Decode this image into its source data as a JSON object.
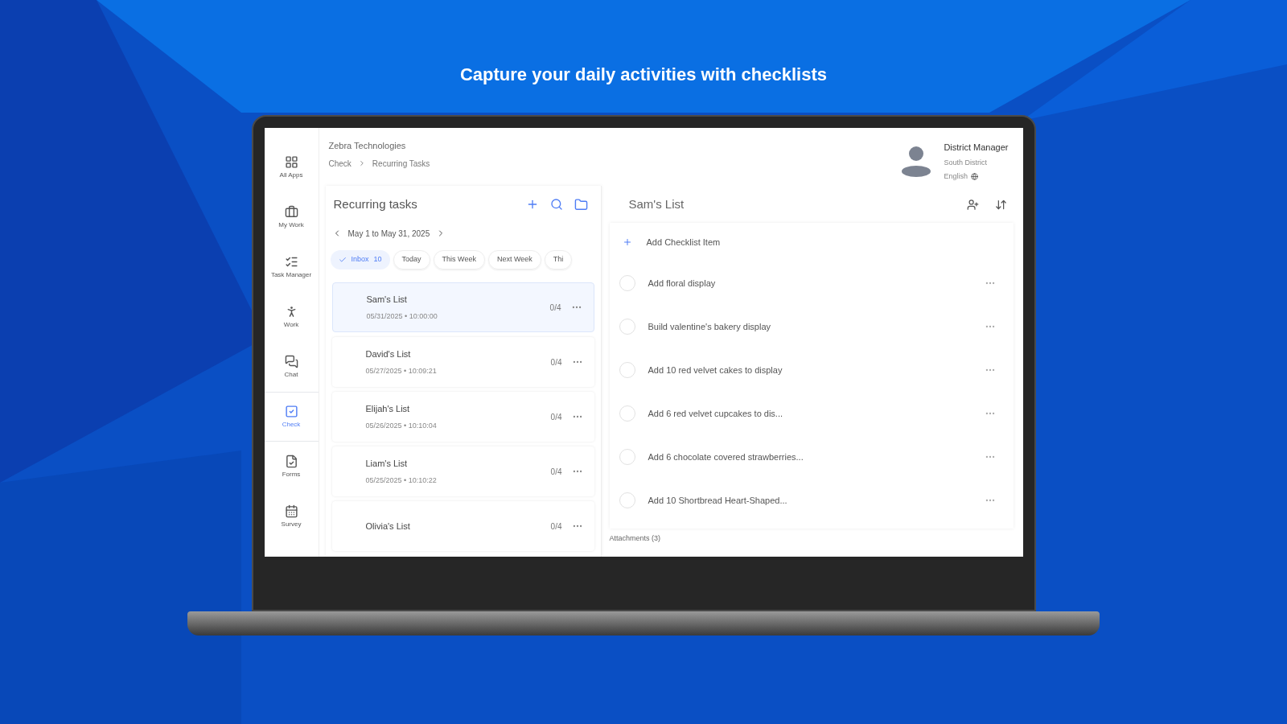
{
  "headline": "Capture your daily activities with checklists",
  "app": {
    "sidebar": {
      "items": [
        {
          "kind": "grid",
          "label": "All Apps",
          "selected": false
        },
        {
          "kind": "briefcase",
          "label": "My Work",
          "selected": false
        },
        {
          "kind": "tasks",
          "label": "Task Manager",
          "selected": false
        },
        {
          "kind": "person",
          "label": "Work",
          "selected": false
        },
        {
          "kind": "chat",
          "label": "Chat",
          "selected": false
        },
        {
          "kind": "check",
          "label": "Check",
          "selected": true
        },
        {
          "kind": "forms",
          "label": "Forms",
          "selected": false
        },
        {
          "kind": "survey",
          "label": "Survey",
          "selected": false
        }
      ]
    },
    "header": {
      "organization": "Zebra Technologies",
      "breadcrumbs": [
        "Check",
        "Recurring Tasks"
      ],
      "user": {
        "role": "District Manager",
        "district": "South District",
        "language": "English"
      }
    },
    "list_panel": {
      "title": "Recurring tasks",
      "date_range": "May 1 to May 31, 2025",
      "filters": [
        {
          "label": "Inbox",
          "count": "10",
          "selected": true
        },
        {
          "label": "Today",
          "selected": false
        },
        {
          "label": "This Week",
          "selected": false
        },
        {
          "label": "Next Week",
          "selected": false
        },
        {
          "label": "Thi",
          "selected": false
        }
      ],
      "lists": [
        {
          "name": "Sam's List",
          "date": "05/31/2025 • 10:00:00",
          "progress": "0/4",
          "selected": true
        },
        {
          "name": "David's List",
          "date": "05/27/2025 • 10:09:21",
          "progress": "0/4",
          "selected": false
        },
        {
          "name": "Elijah's List",
          "date": "05/26/2025 • 10:10:04",
          "progress": "0/4",
          "selected": false
        },
        {
          "name": "Liam's List",
          "date": "05/25/2025 • 10:10:22",
          "progress": "0/4",
          "selected": false
        },
        {
          "name": "Olivia's List",
          "progress": "0/4",
          "selected": false
        }
      ]
    },
    "detail_panel": {
      "title": "Sam's List",
      "add_label": "Add Checklist Item",
      "items": [
        {
          "text": "Add floral display",
          "checked": false
        },
        {
          "text": "Build valentine's bakery display",
          "checked": false
        },
        {
          "text": "Add 10 red velvet cakes to display",
          "checked": false
        },
        {
          "text": "Add 6 red velvet cupcakes to dis...",
          "checked": false
        },
        {
          "text": "Add 6 chocolate covered strawberries...",
          "checked": false
        },
        {
          "text": "Add 10 Shortbread Heart-Shaped...",
          "checked": false
        }
      ],
      "attachments": "Attachments (3)"
    }
  }
}
